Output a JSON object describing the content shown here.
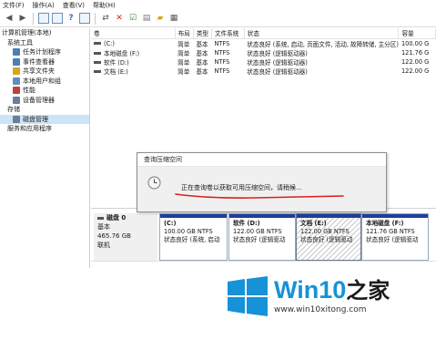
{
  "menu": [
    "文件(F)",
    "操作(A)",
    "查看(V)",
    "帮助(H)"
  ],
  "tree": [
    {
      "label": "计算机管理(本地)",
      "indent": 0
    },
    {
      "label": "系统工具",
      "indent": 1
    },
    {
      "label": "任务计划程序",
      "indent": 2
    },
    {
      "label": "事件查看器",
      "indent": 2
    },
    {
      "label": "共享文件夹",
      "indent": 2
    },
    {
      "label": "本地用户和组",
      "indent": 2
    },
    {
      "label": "性能",
      "indent": 2
    },
    {
      "label": "设备管理器",
      "indent": 2
    },
    {
      "label": "存储",
      "indent": 1
    },
    {
      "label": "磁盘管理",
      "indent": 2
    },
    {
      "label": "服务和应用程序",
      "indent": 1
    }
  ],
  "volumes": {
    "headers": [
      "卷",
      "布局",
      "类型",
      "文件系统",
      "状态",
      "容量"
    ],
    "rows": [
      [
        "(C:)",
        "简单",
        "基本",
        "NTFS",
        "状态良好 (系统, 启动, 页面文件, 活动, 故障转储, 主分区)",
        "100.00 G"
      ],
      [
        "本地磁盘 (F:)",
        "简单",
        "基本",
        "NTFS",
        "状态良好 (逻辑驱动器)",
        "121.76 G"
      ],
      [
        "软件 (D:)",
        "简单",
        "基本",
        "NTFS",
        "状态良好 (逻辑驱动器)",
        "122.00 G"
      ],
      [
        "文档 (E:)",
        "简单",
        "基本",
        "NTFS",
        "状态良好 (逻辑驱动器)",
        "122.00 G"
      ]
    ]
  },
  "dialog": {
    "title": "查询压缩空间",
    "message": "正在查询卷以获取可用压缩空间，请稍候..."
  },
  "disk": {
    "name": "磁盘 0",
    "type": "基本",
    "size": "465.76 GB",
    "status": "联机",
    "partitions": [
      {
        "name": "(C:)",
        "size": "100.00 GB NTFS",
        "status": "状态良好 (系统, 启动"
      },
      {
        "name": "软件 (D:)",
        "size": "122.00 GB NTFS",
        "status": "状态良好 (逻辑驱动"
      },
      {
        "name": "文档 (E:)",
        "size": "122.00 GB NTFS",
        "status": "状态良好 (逻辑驱动"
      },
      {
        "name": "本地磁盘 (F:)",
        "size": "121.76 GB NTFS",
        "status": "状态良好 (逻辑驱动"
      }
    ]
  },
  "watermark": {
    "brand": "Win10",
    "brand_suffix": "之家",
    "url": "www.win10xitong.com"
  },
  "colors": {
    "primary_bar": "#1f3fa0",
    "logical_bar": "#2a8a2a",
    "annotation": "#d92020",
    "win_blue": "#1592d8"
  }
}
